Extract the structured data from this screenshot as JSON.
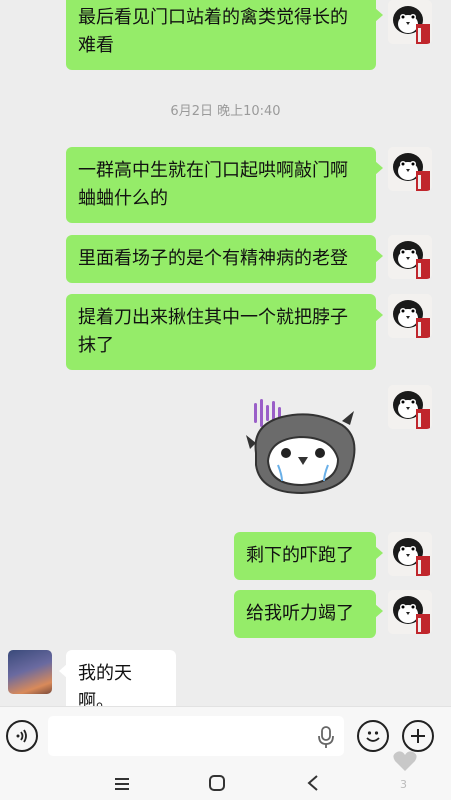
{
  "messages": [
    {
      "side": "out",
      "text": "最后看见门口站着的禽类觉得长的难看"
    },
    {
      "side": "out",
      "text": "一群高中生就在门口起哄啊敲门啊蛐蛐什么的"
    },
    {
      "side": "out",
      "text": "里面看场子的是个有精神病的老登"
    },
    {
      "side": "out",
      "text": "提着刀出来揪住其中一个就把脖子抹了"
    },
    {
      "side": "out",
      "type": "sticker",
      "sticker": "crying-penguin-sticker"
    },
    {
      "side": "out",
      "text": "剩下的吓跑了"
    },
    {
      "side": "out",
      "text": "给我听力竭了"
    },
    {
      "side": "in",
      "text": "我的天啊。"
    }
  ],
  "timestamp": "6月2日 晚上10:40",
  "msg0_line1": "最后看见门口站着的禽类觉得长的",
  "msg0_line2": "难看",
  "msg1_line1": "一群高中生就在门口起哄啊敲门啊",
  "msg1_line2": "蛐蛐什么的",
  "msg2_line1": "里面看场子的是个有精神病的老登",
  "msg3_line1": "提着刀出来揪住其中一个就把脖子",
  "msg3_line2": "抹了",
  "msg5_line1": "剩下的吓跑了",
  "msg6_line1": "给我听力竭了",
  "msg7_line1": "我的天啊。",
  "input": {
    "placeholder": "",
    "value": ""
  },
  "icons": {
    "voice": "voice-icon",
    "mic": "microphone-icon",
    "emoji": "emoji-icon",
    "plus": "plus-icon",
    "heart": "heart-icon"
  },
  "badge_count": "3",
  "colors": {
    "outgoing_bubble": "#95ec69",
    "incoming_bubble": "#ffffff",
    "background": "#ededed",
    "timestamp": "#9a9a9a"
  }
}
